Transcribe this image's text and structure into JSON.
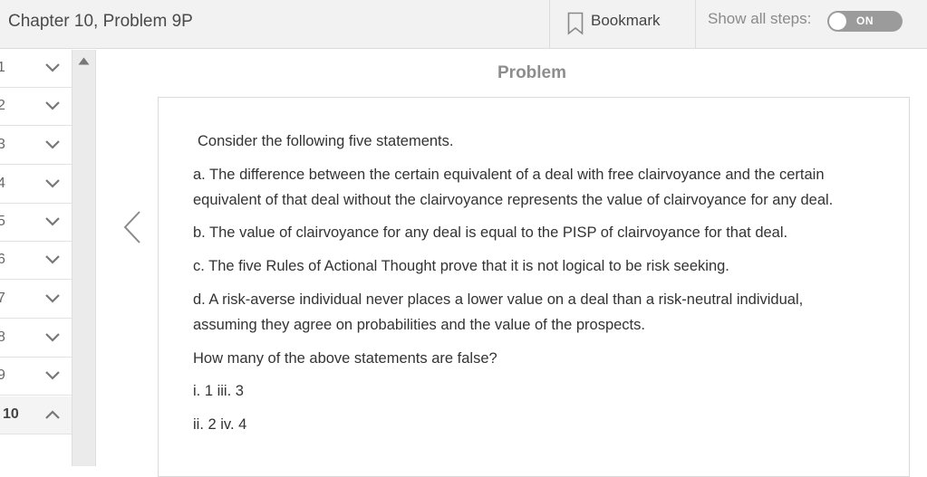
{
  "header": {
    "chapter_title": "Chapter 10, Problem 9P",
    "bookmark_label": "Bookmark",
    "show_steps_label": "Show all steps:",
    "toggle_label": "ON"
  },
  "sidebar": {
    "steps": [
      {
        "num": "1",
        "expanded": false
      },
      {
        "num": "2",
        "expanded": false
      },
      {
        "num": "3",
        "expanded": false
      },
      {
        "num": "4",
        "expanded": false
      },
      {
        "num": "5",
        "expanded": false
      },
      {
        "num": "6",
        "expanded": false
      },
      {
        "num": "7",
        "expanded": false
      },
      {
        "num": "8",
        "expanded": false
      },
      {
        "num": "9",
        "expanded": false
      },
      {
        "num": "10",
        "expanded": true
      }
    ]
  },
  "problem": {
    "heading": "Problem",
    "intro": "Consider the following five statements.",
    "statement_a_line1": "a. The difference between the certain equivalent of a deal with free clairvoyance and the certain",
    "statement_a_line2": "equivalent of that deal without the clairvoyance represents the value of clairvoyance for any deal.",
    "statement_b": "b. The value of clairvoyance for any deal is equal to the PISP of clairvoyance for that deal.",
    "statement_c": "c. The five Rules of Actional Thought prove that it is not logical to be risk seeking.",
    "statement_d_line1": "d. A risk-averse individual never places a lower value on a deal than a risk-neutral individual,",
    "statement_d_line2": "assuming they agree on probabilities and the value of the prospects.",
    "question": "How many of the above statements are false?",
    "options_line1": "i. 1 iii. 3",
    "options_line2": "ii. 2 iv. 4"
  },
  "colors": {
    "header_bg": "#f2f2f2",
    "toggle_bg": "#9b9b9b",
    "heading_color": "#8d8d8d"
  }
}
